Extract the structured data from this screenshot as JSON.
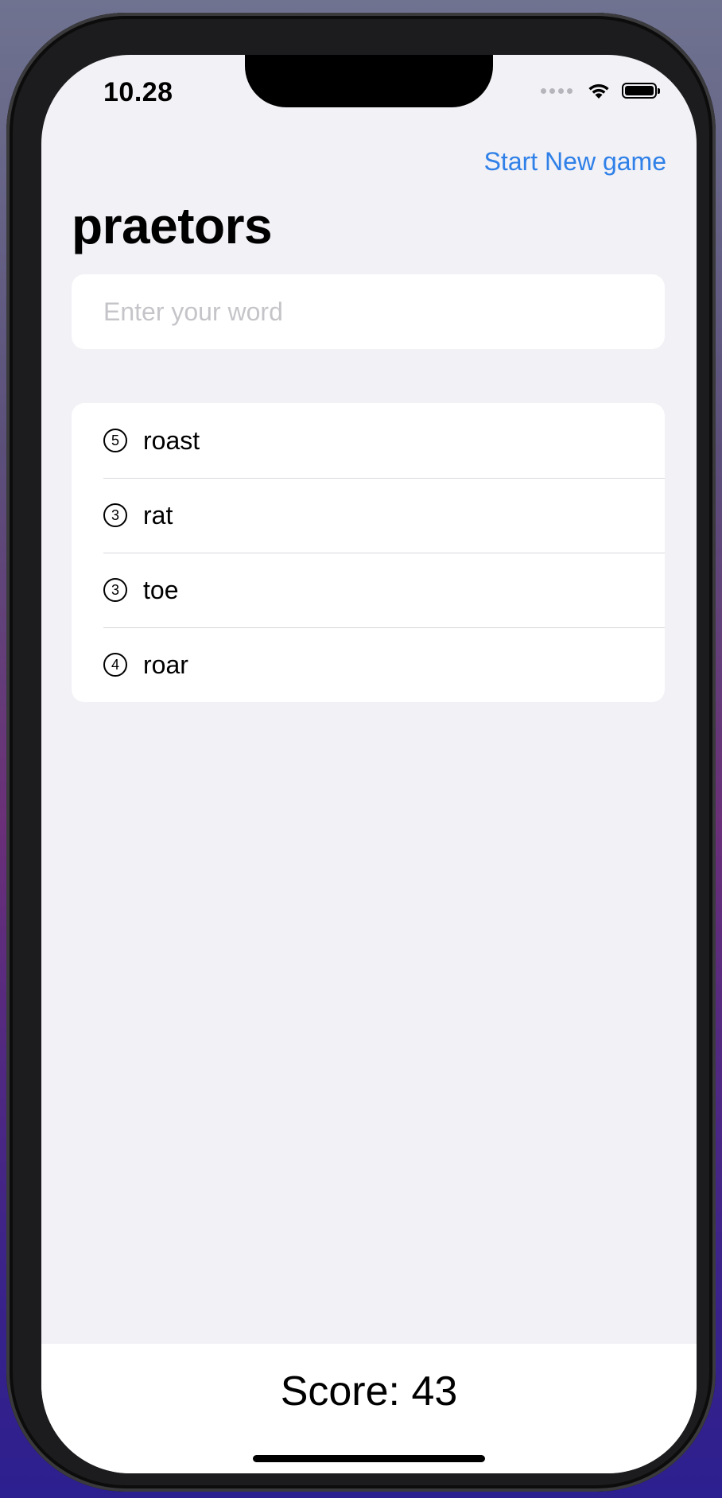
{
  "status_bar": {
    "time": "10.28"
  },
  "header": {
    "action_label": "Start New game",
    "title": "praetors"
  },
  "input": {
    "placeholder": "Enter your word",
    "value": ""
  },
  "words": [
    {
      "count": "5",
      "word": "roast"
    },
    {
      "count": "3",
      "word": "rat"
    },
    {
      "count": "3",
      "word": "toe"
    },
    {
      "count": "4",
      "word": "roar"
    }
  ],
  "footer": {
    "score_label": "Score: 43"
  },
  "colors": {
    "accent": "#2f80e8",
    "background": "#f1f1f6"
  },
  "icons": {
    "wifi": "wifi-icon",
    "battery": "battery-icon",
    "signal": "signal-icon",
    "count": "numbered-circle-icon"
  }
}
